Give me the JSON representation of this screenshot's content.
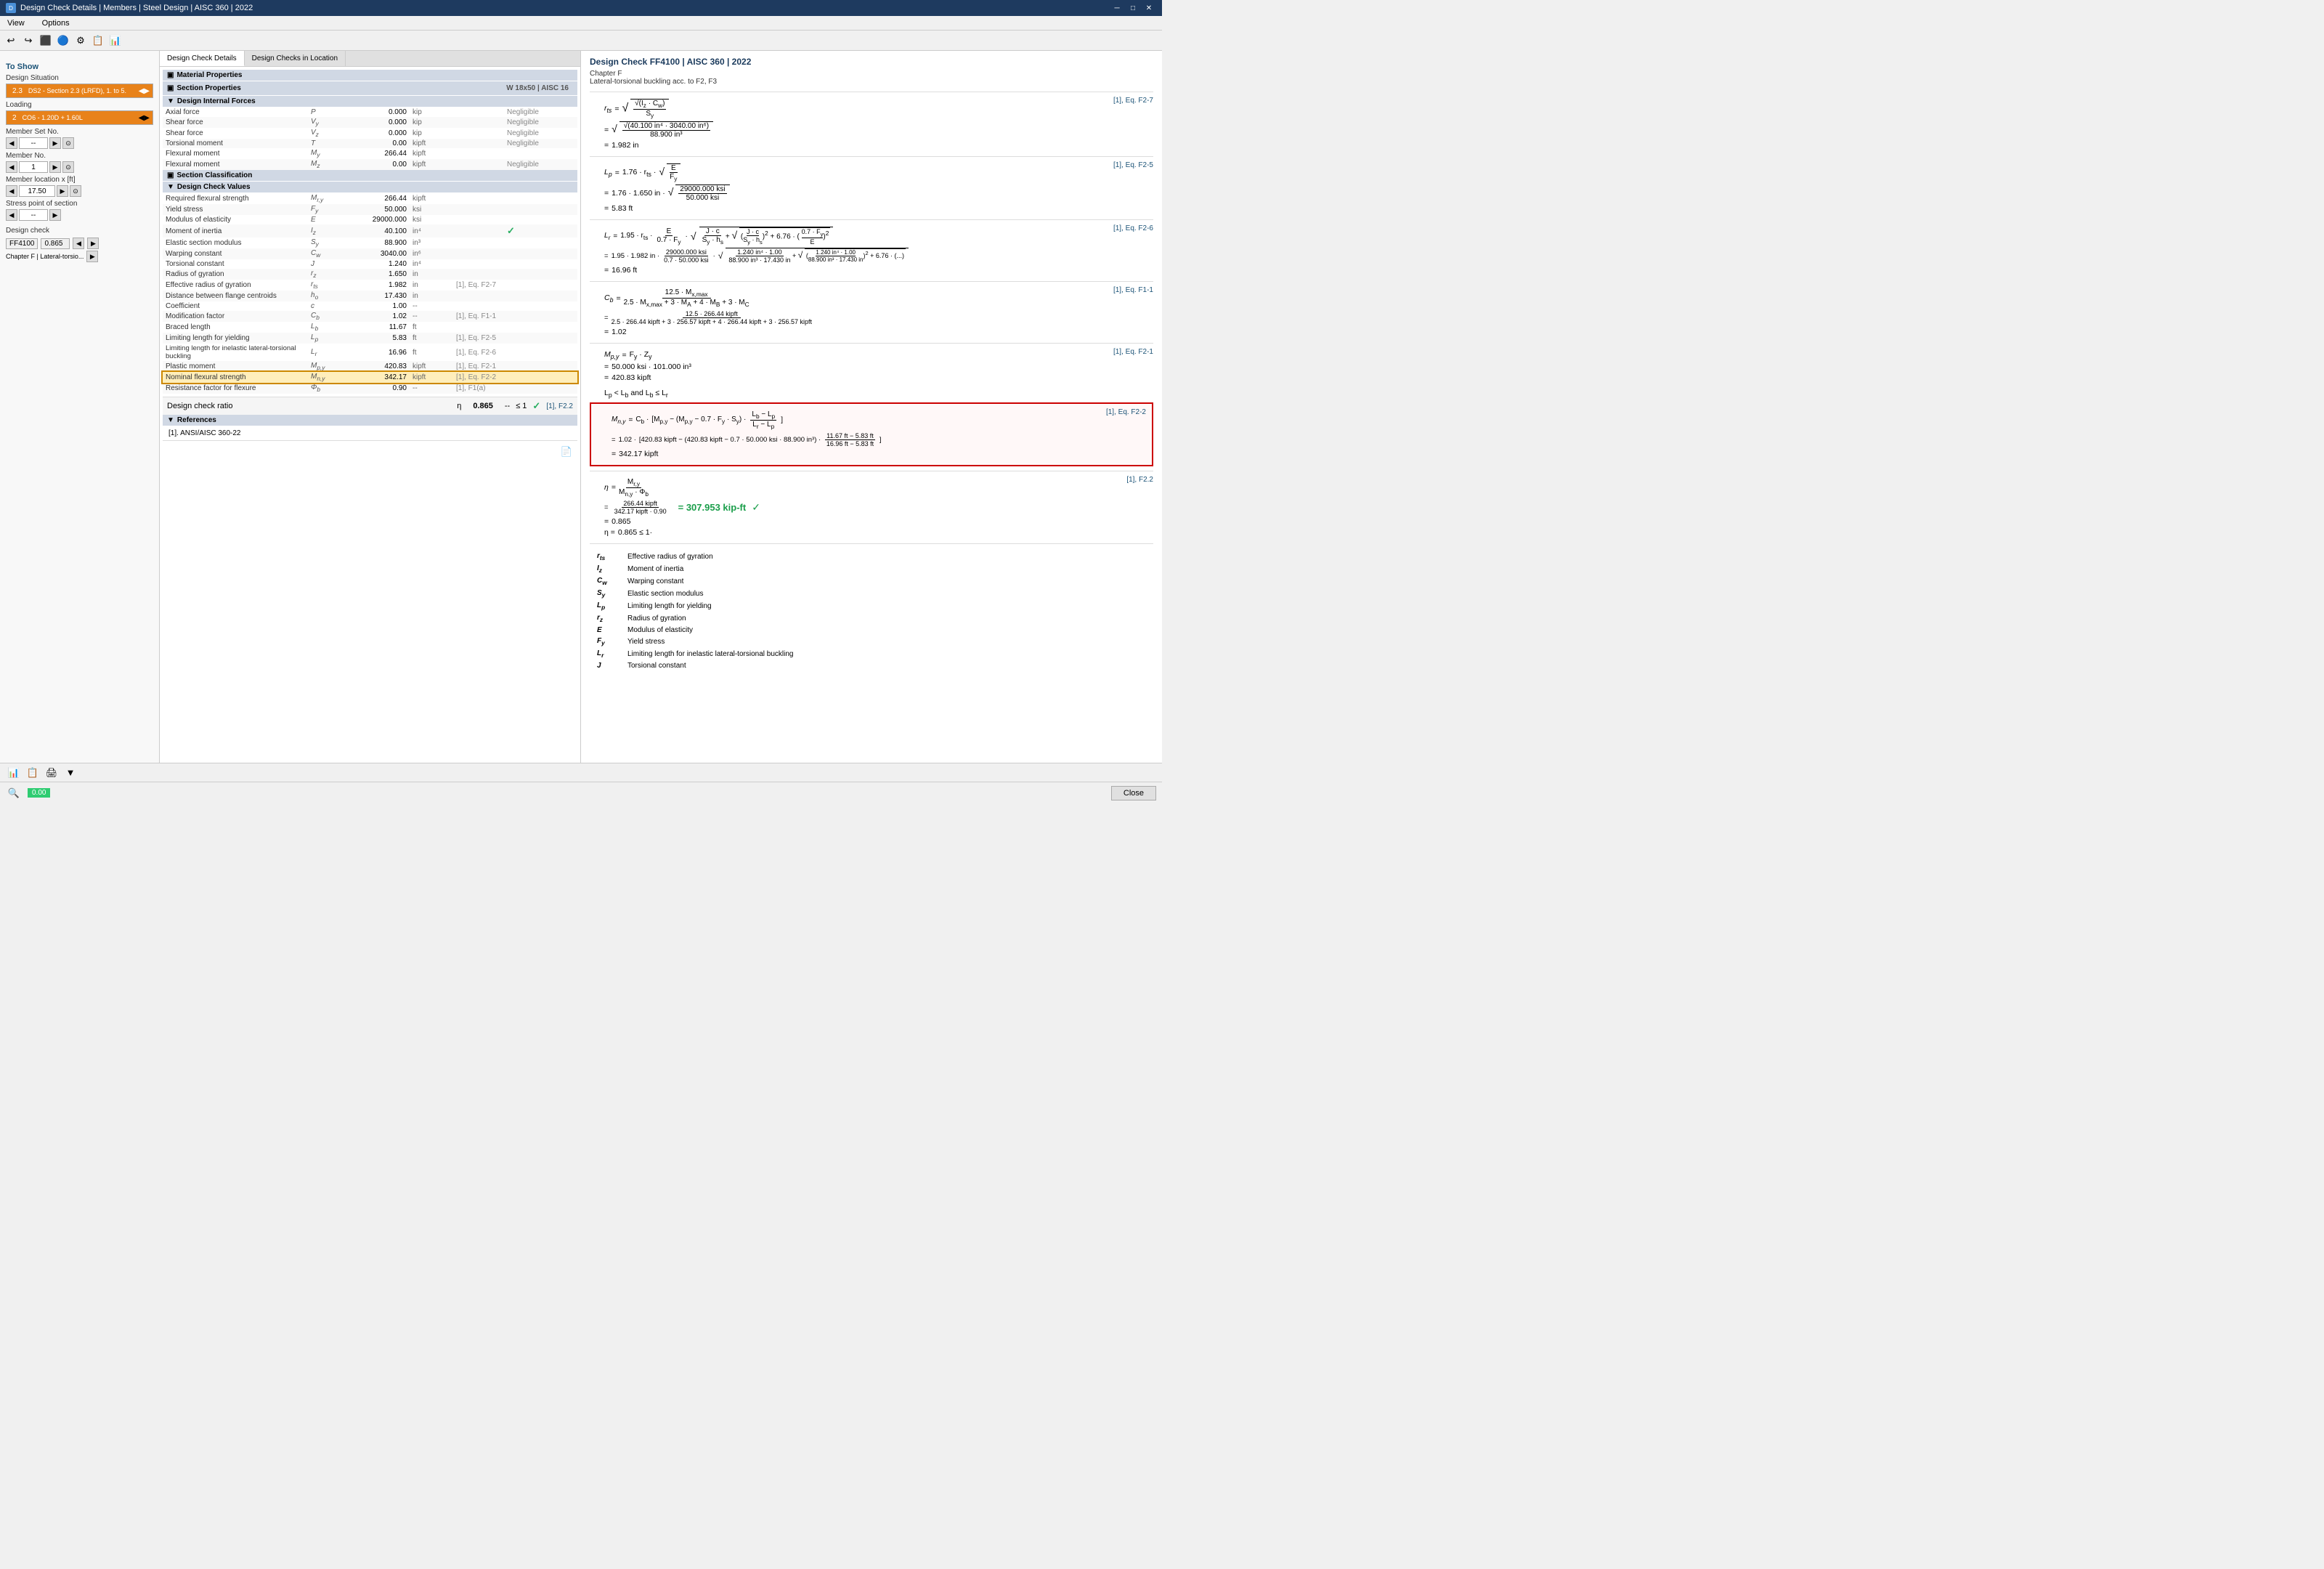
{
  "titleBar": {
    "title": "Design Check Details | Members | Steel Design | AISC 360 | 2022",
    "icon": "D"
  },
  "menuBar": {
    "items": [
      "View",
      "Options"
    ]
  },
  "toolbar": {
    "buttons": [
      "↩",
      "↪",
      "⬛",
      "🔵",
      "⚙",
      "📋",
      "📊"
    ]
  },
  "leftPanel": {
    "toShow": "To Show",
    "designSituation": {
      "label": "Design Situation",
      "badge": "2.3",
      "value": "DS2 - Section 2.3 (LRFD), 1. to 5."
    },
    "loading": {
      "label": "Loading",
      "badge": "2",
      "value": "CO6 - 1.20D + 1.60L"
    },
    "memberSetNo": {
      "label": "Member Set No.",
      "value": "--"
    },
    "memberNo": {
      "label": "Member No.",
      "value": "1"
    },
    "memberLocationX": {
      "label": "Member location x [ft]",
      "value": "17.50"
    },
    "stressPoint": {
      "label": "Stress point of section",
      "value": "--"
    },
    "designCheck": {
      "label": "Design check",
      "value": "FF4100",
      "ratio": "0.865",
      "chapter": "Chapter F | Lateral-torsio..."
    }
  },
  "centerPanel": {
    "tabs": [
      "Design Check Details",
      "Design Checks in Location"
    ],
    "sections": {
      "materialProperties": "Material Properties",
      "sectionProperties": "Section Properties",
      "sectionInfo": "W 18x50 | AISC 16",
      "designInternalForces": "Design Internal Forces",
      "internalForces": [
        {
          "name": "Axial force",
          "symbol": "P",
          "value": "0.000",
          "unit": "kip",
          "note": "Negligible"
        },
        {
          "name": "Shear force",
          "symbol": "Vy",
          "value": "0.000",
          "unit": "kip",
          "note": "Negligible"
        },
        {
          "name": "Shear force",
          "symbol": "Vz",
          "value": "0.000",
          "unit": "kip",
          "note": "Negligible"
        },
        {
          "name": "Torsional moment",
          "symbol": "T",
          "value": "0.00",
          "unit": "kipft",
          "note": "Negligible"
        },
        {
          "name": "Flexural moment",
          "symbol": "My",
          "value": "266.44",
          "unit": "kipft",
          "note": ""
        },
        {
          "name": "Flexural moment",
          "symbol": "Mz",
          "value": "0.00",
          "unit": "kipft",
          "note": "Negligible"
        }
      ],
      "sectionClassification": "Section Classification",
      "designCheckValues": "Design Check Values",
      "checkValues": [
        {
          "name": "Required flexural strength",
          "symbol": "Mr,y",
          "value": "266.44",
          "unit": "kipft",
          "note": "",
          "ref": ""
        },
        {
          "name": "Yield stress",
          "symbol": "Fy",
          "value": "50.000",
          "unit": "ksi",
          "note": "",
          "ref": ""
        },
        {
          "name": "Modulus of elasticity",
          "symbol": "E",
          "value": "29000.000",
          "unit": "ksi",
          "note": "",
          "ref": ""
        },
        {
          "name": "Moment of inertia",
          "symbol": "Iz",
          "value": "40.100",
          "unit": "in⁴",
          "note": "",
          "ref": "",
          "check": true
        },
        {
          "name": "Elastic section modulus",
          "symbol": "Sy",
          "value": "88.900",
          "unit": "in³",
          "note": "",
          "ref": ""
        },
        {
          "name": "Warping constant",
          "symbol": "Cw",
          "value": "3040.00",
          "unit": "in⁶",
          "note": "",
          "ref": ""
        },
        {
          "name": "Torsional constant",
          "symbol": "J",
          "value": "1.240",
          "unit": "in⁴",
          "note": "",
          "ref": ""
        },
        {
          "name": "Radius of gyration",
          "symbol": "rz",
          "value": "1.650",
          "unit": "in",
          "note": "",
          "ref": ""
        },
        {
          "name": "Effective radius of gyration",
          "symbol": "rts",
          "value": "1.982",
          "unit": "in",
          "note": "[1], Eq. F2-7",
          "ref": ""
        },
        {
          "name": "Distance between flange centroids",
          "symbol": "ho",
          "value": "17.430",
          "unit": "in",
          "note": "",
          "ref": ""
        },
        {
          "name": "Coefficient",
          "symbol": "c",
          "value": "1.00",
          "unit": "--",
          "note": "",
          "ref": ""
        },
        {
          "name": "Modification factor",
          "symbol": "Cb",
          "value": "1.02",
          "unit": "--",
          "note": "[1], Eq. F1-1",
          "ref": ""
        },
        {
          "name": "Braced length",
          "symbol": "Lb",
          "value": "11.67",
          "unit": "ft",
          "note": "",
          "ref": ""
        },
        {
          "name": "Limiting length for yielding",
          "symbol": "Lp",
          "value": "5.83",
          "unit": "ft",
          "note": "[1], Eq. F2-5",
          "ref": ""
        },
        {
          "name": "Limiting length for inelastic lateral-torsional buckling",
          "symbol": "Lr",
          "value": "16.96",
          "unit": "ft",
          "note": "[1], Eq. F2-6",
          "ref": ""
        },
        {
          "name": "Plastic moment",
          "symbol": "Mp,y",
          "value": "420.83",
          "unit": "kipft",
          "note": "[1], Eq. F2-1",
          "ref": ""
        },
        {
          "name": "Nominal flexural strength",
          "symbol": "Mn,y",
          "value": "342.17",
          "unit": "kipft",
          "note": "[1], Eq. F2-2",
          "ref": "",
          "highlighted": true
        },
        {
          "name": "Resistance factor for flexure",
          "symbol": "Φb",
          "value": "0.90",
          "unit": "--",
          "note": "[1], F1(a)",
          "ref": ""
        }
      ],
      "designCheckRatio": {
        "label": "Design check ratio",
        "symbol": "η",
        "value": "0.865",
        "condition": "≤ 1",
        "ref": "[1], F2.2",
        "checkMark": "✓"
      },
      "references": {
        "title": "References",
        "items": [
          "[1]. ANSI/AISC 360-22"
        ]
      }
    }
  },
  "rightPanel": {
    "title": "Design Check FF4100 | AISC 360 | 2022",
    "chapter": "Chapter F",
    "subtitle": "Lateral-torsional buckling acc. to F2, F3",
    "formulas": {
      "rts_label": "rts",
      "rts_eq": "√(√(Iz·Cw) / Sy)",
      "rts_calc": "√(√(40.100 in⁴ · 3040.00 in⁶) / 88.900 in³)",
      "rts_result": "1.982 in",
      "rts_ref": "[1], Eq. F2-7",
      "Lp_label": "Lp",
      "Lp_eq": "1.76 · rts · √(E/Fy)",
      "Lp_calc": "1.76 · 1.650 in · √(29000.000 ksi / 50.000 ksi)",
      "Lp_result": "5.83 ft",
      "Lp_ref": "[1], Eq. F2-5",
      "Lr_label": "Lr",
      "Lr_eq_desc": "1.95 · rts · (E / 0.7·Fy) · √(J·c/(Sy·ho) + √((J·c/(Sy·ho))² + 6.76·(0.7·Fy/E)²))",
      "Lr_calc1": "1.95 · 1.982 in · (29000.000 ksi / (0.7 · 50.000 ksi)) · √((1.240 in⁴ · 1.00 / (88.900 in³ · 17.430 in)) + √((1.240 in⁴ · 1.00 / (88.900 in³ · 17.430 in))² + 6.76 · (...)))",
      "Lr_result": "16.96 ft",
      "Lr_ref": "[1], Eq. F2-6",
      "Cb_label": "Cb",
      "Cb_eq": "12.5 · Mx,max / (2.5 · Mx,max + 3 · MA + 4 · MB + 3 · MC)",
      "Cb_calc": "12.5 · 266.44 kipft / (2.5 · 266.44 kipft + 3 · 256.57 kipft + 4 · 266.44 kipft + 3 · 256.57 kipft)",
      "Cb_result": "1.02",
      "Cb_ref": "[1], Eq. F1-1",
      "Mpy_label": "Mp,y",
      "Mpy_eq": "Fy · Zy",
      "Mpy_calc": "50.000 ksi · 101.000 in³",
      "Mpy_result": "420.83 kipft",
      "Mpy_ref": "[1], Eq. F2-1",
      "condition": "Lp < Lb and Lb ≤ Lr",
      "Mny_label": "Mn,y",
      "Mny_eq": "Cb · [Mp,y - (Mp,y - 0.7 · Fy · Sy) · (Lb - Lp)/(Lr - Lp)]",
      "Mny_calc": "1.02 · [420.83 kipft - (420.83 kipft - 0.7 · 50.000 ksi · 88.900 in³) · (11.67 ft - 5.83 ft)/(16.96 ft - 5.83 ft)]",
      "Mny_result": "342.17 kipft",
      "Mny_ref": "[1], Eq. F2-2",
      "eta_label": "η",
      "eta_eq": "Mr,y / (Mn,y · Φb)",
      "eta_calc": "266.44 kipft / (342.17 kipft · 0.90)",
      "eta_result_display": "= 307.953 kip-ft",
      "eta_result": "0.865",
      "eta_condition": "0.865 ≤ 1·",
      "eta_ref": "[1], F2.2"
    },
    "legend": [
      {
        "symbol": "rts",
        "desc": "Effective radius of gyration"
      },
      {
        "symbol": "Iz",
        "desc": "Moment of inertia"
      },
      {
        "symbol": "Cw",
        "desc": "Warping constant"
      },
      {
        "symbol": "Sy",
        "desc": "Elastic section modulus"
      },
      {
        "symbol": "Lp",
        "desc": "Limiting length for yielding"
      },
      {
        "symbol": "rz",
        "desc": "Radius of gyration"
      },
      {
        "symbol": "E",
        "desc": "Modulus of elasticity"
      },
      {
        "symbol": "Fy",
        "desc": "Yield stress"
      },
      {
        "symbol": "Lr",
        "desc": "Limiting length for inelastic lateral-torsional buckling"
      },
      {
        "symbol": "J",
        "desc": "Torsional constant"
      }
    ]
  },
  "bottomBar": {
    "closeLabel": "Close"
  }
}
